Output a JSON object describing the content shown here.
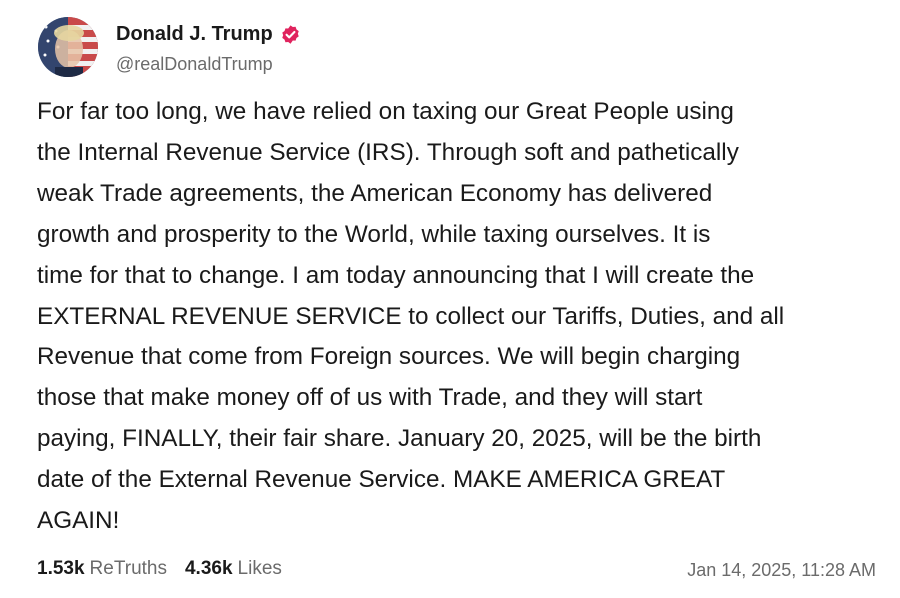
{
  "author": {
    "display_name": "Donald J. Trump",
    "handle": "@realDonaldTrump",
    "verified_color": "#e0245e"
  },
  "post": {
    "lines": [
      "For far too long, we have relied on taxing our Great People using",
      "the Internal Revenue Service (IRS). Through soft and pathetically",
      "weak Trade agreements, the American Economy has delivered",
      "growth and prosperity to the World, while taxing ourselves. It is",
      "time for that to change. I am today announcing that I will create the",
      "EXTERNAL REVENUE SERVICE to collect our Tariffs, Duties, and all",
      "Revenue that come from Foreign sources. We will begin charging",
      "those that make money off of us with Trade, and they will start",
      "paying, FINALLY, their fair share. January 20, 2025, will be the birth",
      "date of the External Revenue Service. MAKE AMERICA GREAT",
      "AGAIN!"
    ]
  },
  "stats": {
    "retruths_count": "1.53k",
    "retruths_label": "ReTruths",
    "likes_count": "4.36k",
    "likes_label": "Likes"
  },
  "timestamp": "Jan 14, 2025, 11:28 AM",
  "colors": {
    "text": "#1a1a1a",
    "muted": "#6b6b6b",
    "background": "#ffffff"
  }
}
